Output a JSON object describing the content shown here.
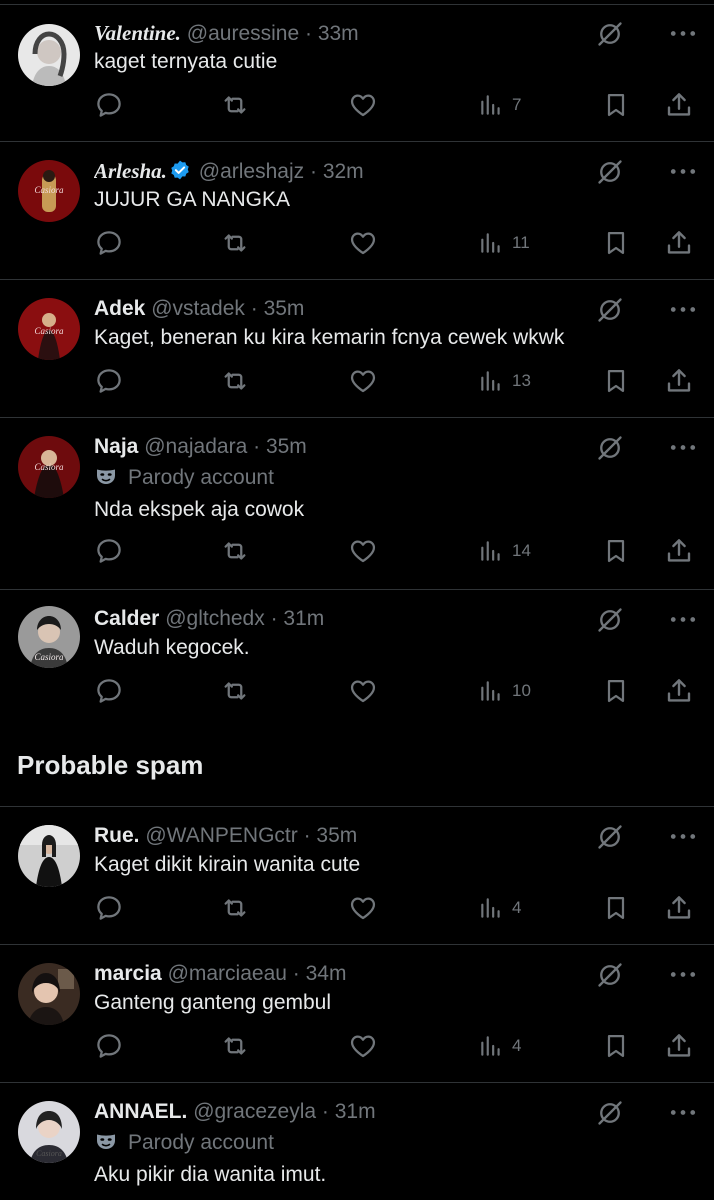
{
  "colors": {
    "background": "#000000",
    "text": "#e7e9ea",
    "muted": "#71767b",
    "divider": "#2f3336",
    "verified": "#1d9bf0"
  },
  "posts": [
    {
      "name": "Valentine.",
      "handle": "@auressine",
      "time": "33m",
      "text": "kaget ternyata cutie",
      "views": "7",
      "verified": false,
      "parody": false
    },
    {
      "name": "Arlesha.",
      "handle": "@arleshajz",
      "time": "32m",
      "text": "JUJUR GA NANGKA",
      "views": "11",
      "verified": true,
      "parody": false
    },
    {
      "name": "Adek",
      "handle": "@vstadek",
      "time": "35m",
      "text": "Kaget, beneran ku kira kemarin fcnya cewek wkwk",
      "views": "13",
      "verified": false,
      "parody": false
    },
    {
      "name": "Naja",
      "handle": "@najadara",
      "time": "35m",
      "text": "Nda ekspek aja cowok",
      "views": "14",
      "verified": false,
      "parody": true
    },
    {
      "name": "Calder",
      "handle": "@gltchedx",
      "time": "31m",
      "text": "Waduh kegocek.",
      "views": "10",
      "verified": false,
      "parody": false
    },
    {
      "name": "Rue.",
      "handle": "@WANPENGctr",
      "time": "35m",
      "text": "Kaget dikit kirain wanita cute",
      "views": "4",
      "verified": false,
      "parody": false
    },
    {
      "name": "marcia",
      "handle": "@marciaeau",
      "time": "34m",
      "text": "Ganteng ganteng gembul",
      "views": "4",
      "verified": false,
      "parody": false
    },
    {
      "name": "ANNAEL.",
      "handle": "@gracezeyla",
      "time": "31m",
      "text": "Aku pikir dia wanita imut.",
      "views": "",
      "verified": false,
      "parody": true
    }
  ],
  "parody_label": "Parody account",
  "section_title": "Probable spam",
  "icons": [
    "reply-icon",
    "repost-icon",
    "like-icon",
    "views-icon",
    "bookmark-icon",
    "share-icon",
    "mute-icon",
    "more-icon",
    "verified-icon",
    "parody-mask-icon"
  ]
}
